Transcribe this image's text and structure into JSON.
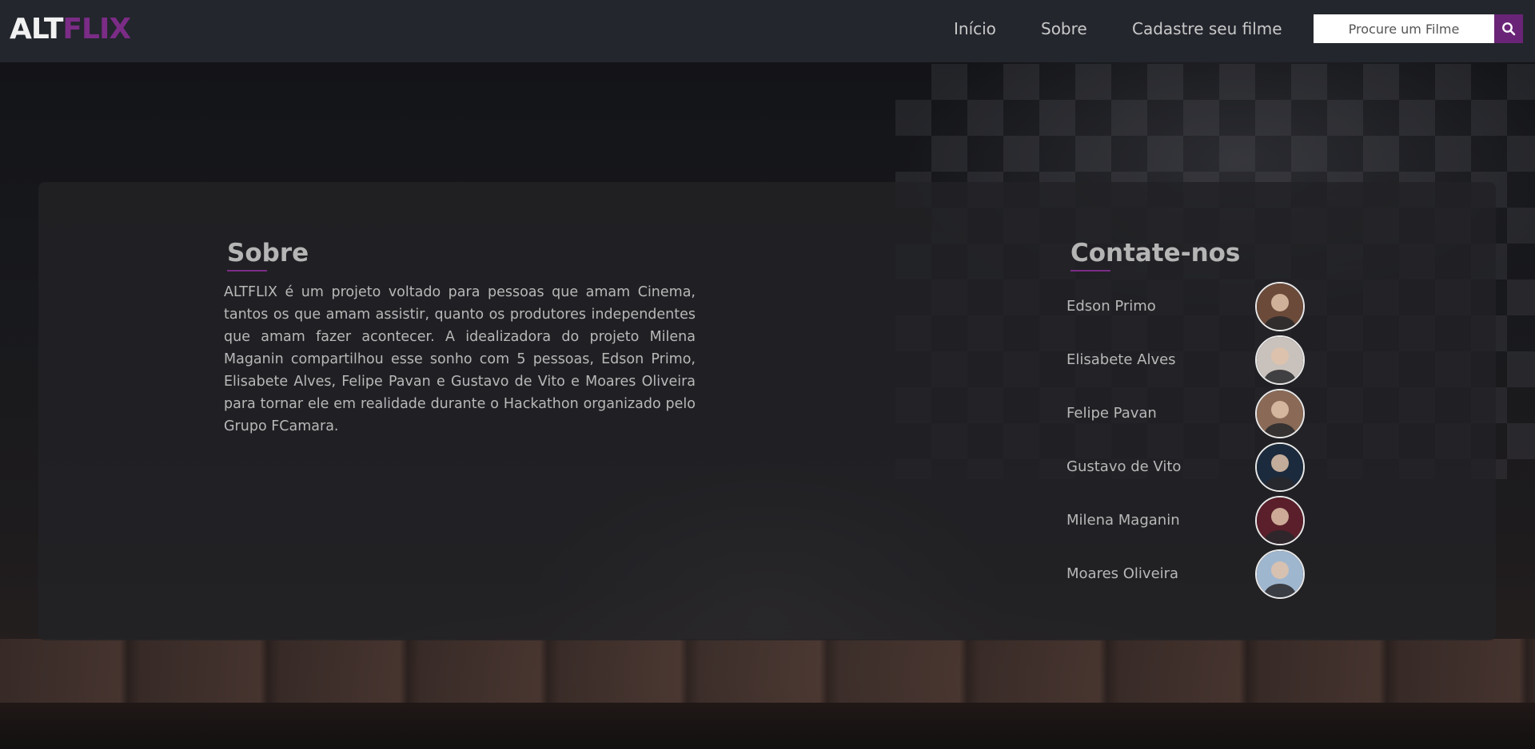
{
  "header": {
    "logo": {
      "part1": "ALT",
      "part2": "FLIX"
    },
    "nav": [
      {
        "label": "Início"
      },
      {
        "label": "Sobre"
      },
      {
        "label": "Cadastre seu filme"
      }
    ],
    "search": {
      "placeholder": "Procure um Filme",
      "icon": "search-icon"
    }
  },
  "about": {
    "title": "Sobre",
    "text": "ALTFLIX é um projeto voltado para pessoas que amam Cinema, tantos os que amam assistir, quanto os produtores independentes que amam fazer acontecer. A idealizadora do projeto Milena Maganin compartilhou esse sonho com 5 pessoas, Edson Primo, Elisabete Alves, Felipe Pavan e Gustavo de Vito e Moares Oliveira para tornar ele em realidade durante o Hackathon organizado pelo Grupo FCamara."
  },
  "contact": {
    "title": "Contate-nos",
    "people": [
      {
        "name": "Edson Primo",
        "avatar_color": "#6b4a3a"
      },
      {
        "name": "Elisabete Alves",
        "avatar_color": "#c9c1bb"
      },
      {
        "name": "Felipe Pavan",
        "avatar_color": "#8a6a56"
      },
      {
        "name": "Gustavo de Vito",
        "avatar_color": "#1c2a3d"
      },
      {
        "name": "Milena Maganin",
        "avatar_color": "#5a1f2a"
      },
      {
        "name": "Moares Oliveira",
        "avatar_color": "#9fb6cf"
      }
    ]
  },
  "colors": {
    "header_bg": "#23262d",
    "accent": "#7b2c86",
    "search_button": "#6a2477",
    "panel_bg": "#222226"
  }
}
